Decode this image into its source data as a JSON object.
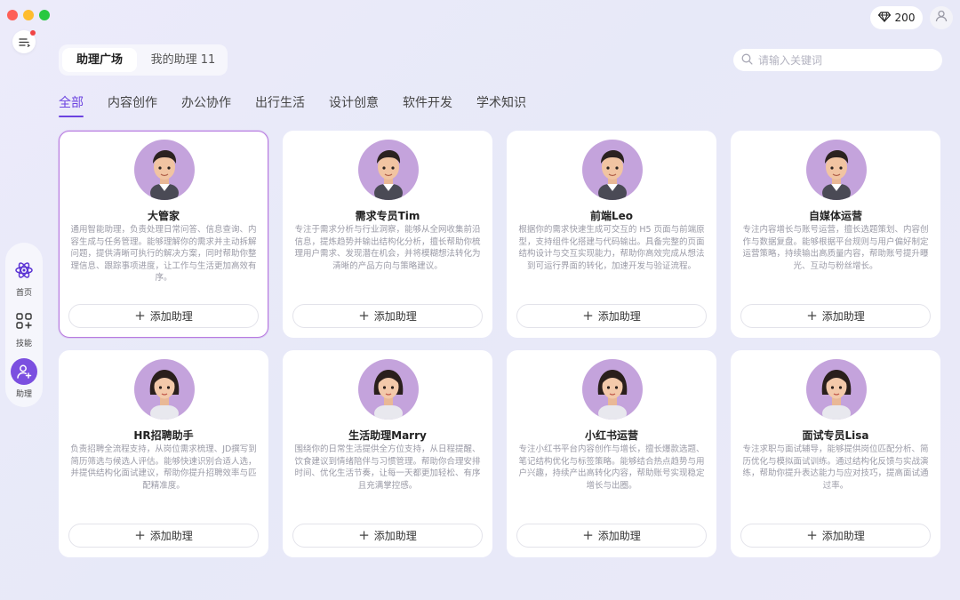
{
  "window": {
    "controls": [
      "close",
      "minimize",
      "maximize"
    ]
  },
  "header": {
    "coins": "200",
    "coin_icon": "diamond-icon",
    "avatar_icon": "user-icon"
  },
  "top_tabs": [
    {
      "label": "助理广场",
      "active": true
    },
    {
      "label": "我的助理 11",
      "active": false
    }
  ],
  "search": {
    "placeholder": "请输入关键词",
    "value": ""
  },
  "categories": [
    {
      "label": "全部",
      "active": true
    },
    {
      "label": "内容创作",
      "active": false
    },
    {
      "label": "办公协作",
      "active": false
    },
    {
      "label": "出行生活",
      "active": false
    },
    {
      "label": "设计创意",
      "active": false
    },
    {
      "label": "软件开发",
      "active": false
    },
    {
      "label": "学术知识",
      "active": false
    }
  ],
  "sidebar": {
    "items": [
      {
        "label": "首页",
        "icon": "atom-icon",
        "active": false
      },
      {
        "label": "技能",
        "icon": "grid-plus-icon",
        "active": false
      },
      {
        "label": "助理",
        "icon": "person-add-icon",
        "active": true
      }
    ]
  },
  "add_label": "添加助理",
  "assistants": [
    {
      "name": "大管家",
      "gender": "male",
      "desc": "通用智能助理，负责处理日常问答、信息查询、内容生成与任务管理。能够理解你的需求并主动拆解问题，提供清晰可执行的解决方案，同时帮助你整理信息、跟踪事项进度，让工作与生活更加高效有序。"
    },
    {
      "name": "需求专员Tim",
      "gender": "male",
      "desc": "专注于需求分析与行业洞察，能够从全网收集前沿信息，提炼趋势并输出结构化分析，擅长帮助你梳理用户需求、发现潜在机会，并将模糊想法转化为清晰的产品方向与策略建议。"
    },
    {
      "name": "前端Leo",
      "gender": "male",
      "desc": "根据你的需求快速生成可交互的 H5 页面与前端原型，支持组件化搭建与代码输出。具备完整的页面结构设计与交互实现能力，帮助你高效完成从想法到可运行界面的转化，加速开发与验证流程。"
    },
    {
      "name": "自媒体运营",
      "gender": "male",
      "desc": "专注内容增长与账号运营，擅长选题策划、内容创作与数据复盘。能够根据平台规则与用户偏好制定运营策略，持续输出高质量内容，帮助账号提升曝光、互动与粉丝增长。"
    },
    {
      "name": "HR招聘助手",
      "gender": "female",
      "desc": "负责招聘全流程支持，从岗位需求梳理、JD撰写到简历筛选与候选人评估。能够快速识别合适人选，并提供结构化面试建议，帮助你提升招聘效率与匹配精准度。"
    },
    {
      "name": "生活助理Marry",
      "gender": "female",
      "desc": "围绕你的日常生活提供全方位支持，从日程提醒、饮食建议到情绪陪伴与习惯管理。帮助你合理安排时间、优化生活节奏，让每一天都更加轻松、有序且充满掌控感。"
    },
    {
      "name": "小红书运营",
      "gender": "female",
      "desc": "专注小红书平台内容创作与增长，擅长爆款选题、笔记结构优化与标签策略。能够结合热点趋势与用户兴趣，持续产出高转化内容，帮助账号实现稳定增长与出圈。"
    },
    {
      "name": "面试专员Lisa",
      "gender": "female",
      "desc": "专注求职与面试辅导，能够提供岗位匹配分析、简历优化与模拟面试训练。通过结构化反馈与实战演练，帮助你提升表达能力与应对技巧，提高面试通过率。"
    }
  ],
  "colors": {
    "accent": "#6c43e0",
    "selected_border": "#b87be0",
    "avatar_bg": "#c4a3dc"
  }
}
